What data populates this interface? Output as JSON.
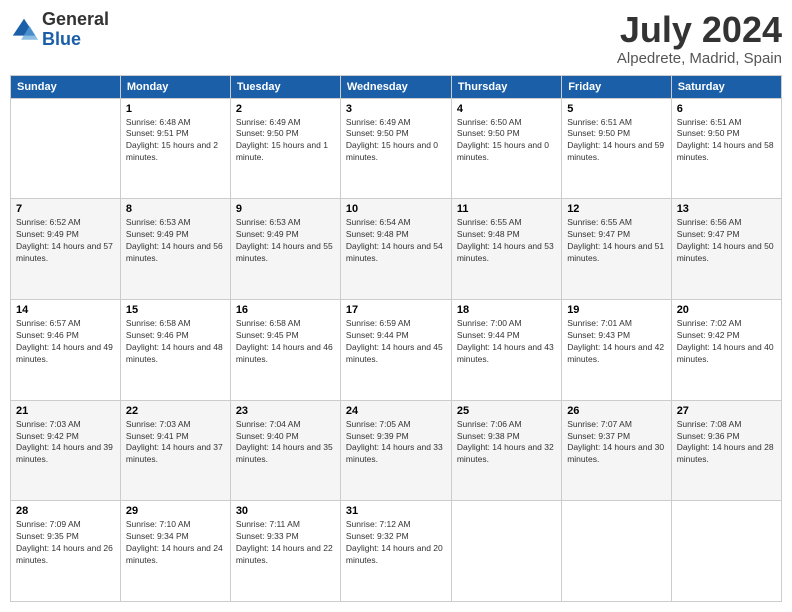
{
  "header": {
    "logo": {
      "general": "General",
      "blue": "Blue"
    },
    "title": "July 2024",
    "location": "Alpedrete, Madrid, Spain"
  },
  "weekdays": [
    "Sunday",
    "Monday",
    "Tuesday",
    "Wednesday",
    "Thursday",
    "Friday",
    "Saturday"
  ],
  "weeks": [
    [
      {
        "day": "",
        "sunrise": "",
        "sunset": "",
        "daylight": ""
      },
      {
        "day": "1",
        "sunrise": "Sunrise: 6:48 AM",
        "sunset": "Sunset: 9:51 PM",
        "daylight": "Daylight: 15 hours and 2 minutes."
      },
      {
        "day": "2",
        "sunrise": "Sunrise: 6:49 AM",
        "sunset": "Sunset: 9:50 PM",
        "daylight": "Daylight: 15 hours and 1 minute."
      },
      {
        "day": "3",
        "sunrise": "Sunrise: 6:49 AM",
        "sunset": "Sunset: 9:50 PM",
        "daylight": "Daylight: 15 hours and 0 minutes."
      },
      {
        "day": "4",
        "sunrise": "Sunrise: 6:50 AM",
        "sunset": "Sunset: 9:50 PM",
        "daylight": "Daylight: 15 hours and 0 minutes."
      },
      {
        "day": "5",
        "sunrise": "Sunrise: 6:51 AM",
        "sunset": "Sunset: 9:50 PM",
        "daylight": "Daylight: 14 hours and 59 minutes."
      },
      {
        "day": "6",
        "sunrise": "Sunrise: 6:51 AM",
        "sunset": "Sunset: 9:50 PM",
        "daylight": "Daylight: 14 hours and 58 minutes."
      }
    ],
    [
      {
        "day": "7",
        "sunrise": "Sunrise: 6:52 AM",
        "sunset": "Sunset: 9:49 PM",
        "daylight": "Daylight: 14 hours and 57 minutes."
      },
      {
        "day": "8",
        "sunrise": "Sunrise: 6:53 AM",
        "sunset": "Sunset: 9:49 PM",
        "daylight": "Daylight: 14 hours and 56 minutes."
      },
      {
        "day": "9",
        "sunrise": "Sunrise: 6:53 AM",
        "sunset": "Sunset: 9:49 PM",
        "daylight": "Daylight: 14 hours and 55 minutes."
      },
      {
        "day": "10",
        "sunrise": "Sunrise: 6:54 AM",
        "sunset": "Sunset: 9:48 PM",
        "daylight": "Daylight: 14 hours and 54 minutes."
      },
      {
        "day": "11",
        "sunrise": "Sunrise: 6:55 AM",
        "sunset": "Sunset: 9:48 PM",
        "daylight": "Daylight: 14 hours and 53 minutes."
      },
      {
        "day": "12",
        "sunrise": "Sunrise: 6:55 AM",
        "sunset": "Sunset: 9:47 PM",
        "daylight": "Daylight: 14 hours and 51 minutes."
      },
      {
        "day": "13",
        "sunrise": "Sunrise: 6:56 AM",
        "sunset": "Sunset: 9:47 PM",
        "daylight": "Daylight: 14 hours and 50 minutes."
      }
    ],
    [
      {
        "day": "14",
        "sunrise": "Sunrise: 6:57 AM",
        "sunset": "Sunset: 9:46 PM",
        "daylight": "Daylight: 14 hours and 49 minutes."
      },
      {
        "day": "15",
        "sunrise": "Sunrise: 6:58 AM",
        "sunset": "Sunset: 9:46 PM",
        "daylight": "Daylight: 14 hours and 48 minutes."
      },
      {
        "day": "16",
        "sunrise": "Sunrise: 6:58 AM",
        "sunset": "Sunset: 9:45 PM",
        "daylight": "Daylight: 14 hours and 46 minutes."
      },
      {
        "day": "17",
        "sunrise": "Sunrise: 6:59 AM",
        "sunset": "Sunset: 9:44 PM",
        "daylight": "Daylight: 14 hours and 45 minutes."
      },
      {
        "day": "18",
        "sunrise": "Sunrise: 7:00 AM",
        "sunset": "Sunset: 9:44 PM",
        "daylight": "Daylight: 14 hours and 43 minutes."
      },
      {
        "day": "19",
        "sunrise": "Sunrise: 7:01 AM",
        "sunset": "Sunset: 9:43 PM",
        "daylight": "Daylight: 14 hours and 42 minutes."
      },
      {
        "day": "20",
        "sunrise": "Sunrise: 7:02 AM",
        "sunset": "Sunset: 9:42 PM",
        "daylight": "Daylight: 14 hours and 40 minutes."
      }
    ],
    [
      {
        "day": "21",
        "sunrise": "Sunrise: 7:03 AM",
        "sunset": "Sunset: 9:42 PM",
        "daylight": "Daylight: 14 hours and 39 minutes."
      },
      {
        "day": "22",
        "sunrise": "Sunrise: 7:03 AM",
        "sunset": "Sunset: 9:41 PM",
        "daylight": "Daylight: 14 hours and 37 minutes."
      },
      {
        "day": "23",
        "sunrise": "Sunrise: 7:04 AM",
        "sunset": "Sunset: 9:40 PM",
        "daylight": "Daylight: 14 hours and 35 minutes."
      },
      {
        "day": "24",
        "sunrise": "Sunrise: 7:05 AM",
        "sunset": "Sunset: 9:39 PM",
        "daylight": "Daylight: 14 hours and 33 minutes."
      },
      {
        "day": "25",
        "sunrise": "Sunrise: 7:06 AM",
        "sunset": "Sunset: 9:38 PM",
        "daylight": "Daylight: 14 hours and 32 minutes."
      },
      {
        "day": "26",
        "sunrise": "Sunrise: 7:07 AM",
        "sunset": "Sunset: 9:37 PM",
        "daylight": "Daylight: 14 hours and 30 minutes."
      },
      {
        "day": "27",
        "sunrise": "Sunrise: 7:08 AM",
        "sunset": "Sunset: 9:36 PM",
        "daylight": "Daylight: 14 hours and 28 minutes."
      }
    ],
    [
      {
        "day": "28",
        "sunrise": "Sunrise: 7:09 AM",
        "sunset": "Sunset: 9:35 PM",
        "daylight": "Daylight: 14 hours and 26 minutes."
      },
      {
        "day": "29",
        "sunrise": "Sunrise: 7:10 AM",
        "sunset": "Sunset: 9:34 PM",
        "daylight": "Daylight: 14 hours and 24 minutes."
      },
      {
        "day": "30",
        "sunrise": "Sunrise: 7:11 AM",
        "sunset": "Sunset: 9:33 PM",
        "daylight": "Daylight: 14 hours and 22 minutes."
      },
      {
        "day": "31",
        "sunrise": "Sunrise: 7:12 AM",
        "sunset": "Sunset: 9:32 PM",
        "daylight": "Daylight: 14 hours and 20 minutes."
      },
      {
        "day": "",
        "sunrise": "",
        "sunset": "",
        "daylight": ""
      },
      {
        "day": "",
        "sunrise": "",
        "sunset": "",
        "daylight": ""
      },
      {
        "day": "",
        "sunrise": "",
        "sunset": "",
        "daylight": ""
      }
    ]
  ]
}
